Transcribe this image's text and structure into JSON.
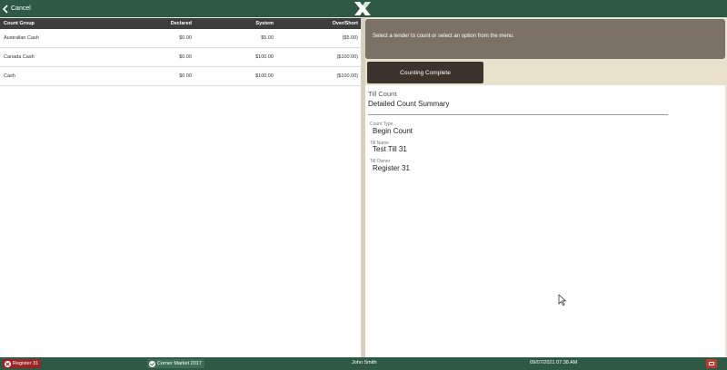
{
  "header": {
    "cancel_label": "Cancel",
    "logo_icon": "x-logo-icon"
  },
  "count_table": {
    "columns": [
      "Count Group",
      "Declared",
      "System",
      "Over/Short"
    ],
    "rows": [
      [
        "Australian Cash",
        "$0.00",
        "$5.00",
        "($5.00)"
      ],
      [
        "Canada Cash",
        "$0.00",
        "$100.00",
        "($100.00)"
      ],
      [
        "Cash",
        "$0.00",
        "$100.00",
        "($100.00)"
      ]
    ]
  },
  "message": "Select a tender to count or select an option from the menu.",
  "actions": {
    "counting_complete": "Counting Complete"
  },
  "summary": {
    "title": "Till Count",
    "subtitle": "Detailed Count Summary",
    "fields": [
      {
        "label": "Count Type",
        "value": "Begin Count"
      },
      {
        "label": "Till Name",
        "value": "Test Till 31"
      },
      {
        "label": "Till Owner",
        "value": "Register 31"
      }
    ]
  },
  "footer": {
    "register": "Register 31",
    "store": "Corner Market 2017",
    "user": "John Smith",
    "datetime": "09/07/2021 07:38 AM"
  },
  "colors": {
    "topbar": "#2e5a45",
    "table_header": "#3b3d3f",
    "message_bg": "#7b7167",
    "button_bg": "#3c342c",
    "register_chip": "#9b2426",
    "store_chip": "#3e6e55",
    "footer_button": "#c0392b"
  }
}
